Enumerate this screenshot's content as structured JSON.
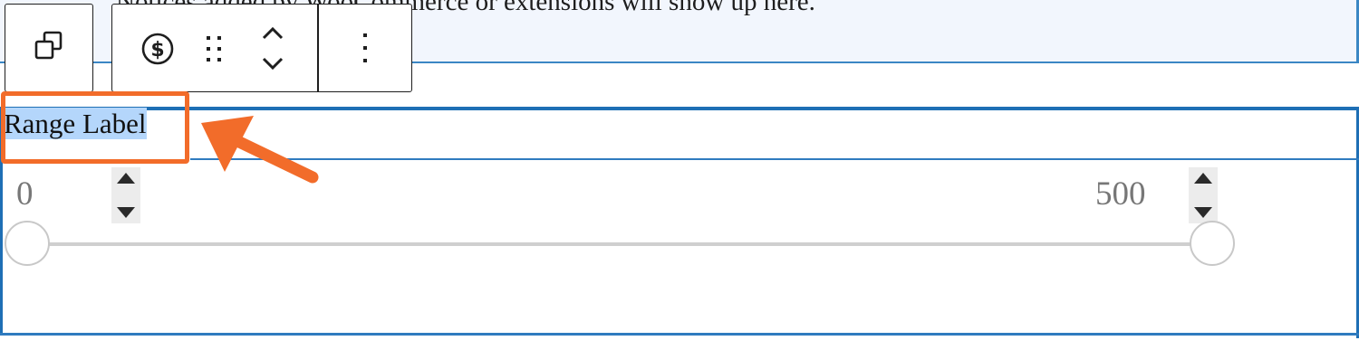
{
  "notice": {
    "text": "Notices added by WooCommerce or extensions will show up here."
  },
  "toolbar": {
    "items": [
      {
        "icon": "copy-blocks-icon"
      },
      {
        "icon": "currency-icon"
      },
      {
        "icon": "drag-handle-icon"
      },
      {
        "icon": "move-up-icon"
      },
      {
        "icon": "move-down-icon"
      },
      {
        "icon": "more-options-icon"
      }
    ]
  },
  "filter": {
    "label": "Range Label",
    "min_value": "0",
    "max_value": "500"
  },
  "colors": {
    "accent": "#1e6fb5",
    "highlight_annotation": "#f26c2a",
    "selection": "#b4d6fb"
  }
}
